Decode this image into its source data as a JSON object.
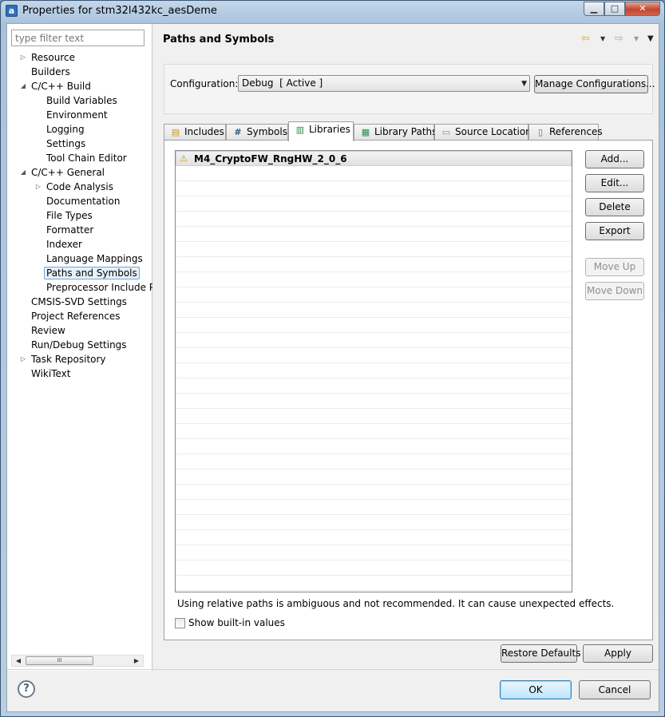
{
  "window": {
    "app_icon": "eclipse-app-icon",
    "title": "Properties for stm32l432kc_aesDeme",
    "minimize_glyph": "▁",
    "maximize_glyph": "□",
    "close_glyph": "✕"
  },
  "sidebar": {
    "filter_placeholder": "type filter text",
    "tree": [
      {
        "label": "Resource",
        "expandable": true
      },
      {
        "label": "Builders"
      },
      {
        "label": "C/C++ Build",
        "expanded": true
      },
      {
        "label": "Build Variables"
      },
      {
        "label": "Environment"
      },
      {
        "label": "Logging"
      },
      {
        "label": "Settings"
      },
      {
        "label": "Tool Chain Editor"
      },
      {
        "label": "C/C++ General",
        "expanded": true
      },
      {
        "label": "Code Analysis",
        "expandable": true
      },
      {
        "label": "Documentation"
      },
      {
        "label": "File Types"
      },
      {
        "label": "Formatter"
      },
      {
        "label": "Indexer"
      },
      {
        "label": "Language Mappings"
      },
      {
        "label": "Paths and Symbols",
        "selected": true
      },
      {
        "label": "Preprocessor Include Pa"
      },
      {
        "label": "CMSIS-SVD Settings"
      },
      {
        "label": "Project References"
      },
      {
        "label": "Review"
      },
      {
        "label": "Run/Debug Settings"
      },
      {
        "label": "Task Repository",
        "expandable": true
      },
      {
        "label": "WikiText"
      }
    ],
    "scroll_thumb_glyph": "III"
  },
  "header": {
    "title": "Paths and Symbols",
    "nav_icons": [
      "back-arrow-icon",
      "forward-arrow-icon",
      "view-menu-icon"
    ]
  },
  "configuration": {
    "label": "Configuration:",
    "value": "Debug  [ Active ]",
    "manage_button": "Manage Configurations..."
  },
  "tabs": [
    {
      "label": "Includes",
      "icon": "includes-icon"
    },
    {
      "label": "Symbols",
      "icon": "hash-icon"
    },
    {
      "label": "Libraries",
      "icon": "libraries-icon",
      "active": true
    },
    {
      "label": "Library Paths",
      "icon": "library-paths-icon"
    },
    {
      "label": "Source Location",
      "icon": "source-location-icon"
    },
    {
      "label": "References",
      "icon": "references-icon"
    }
  ],
  "libraries": {
    "entries": [
      "M4_CryptoFW_RngHW_2_0_6"
    ],
    "buttons": {
      "add": "Add...",
      "edit": "Edit...",
      "delete": "Delete",
      "export": "Export",
      "move_up": "Move Up",
      "move_down": "Move Down"
    },
    "note": "Using relative paths is ambiguous and not recommended. It can cause unexpected effects.",
    "show_builtin": {
      "label": "Show built-in values",
      "checked": false
    }
  },
  "footer": {
    "restore_defaults": "Restore Defaults",
    "apply": "Apply",
    "ok": "OK",
    "cancel": "Cancel",
    "help_glyph": "?"
  }
}
